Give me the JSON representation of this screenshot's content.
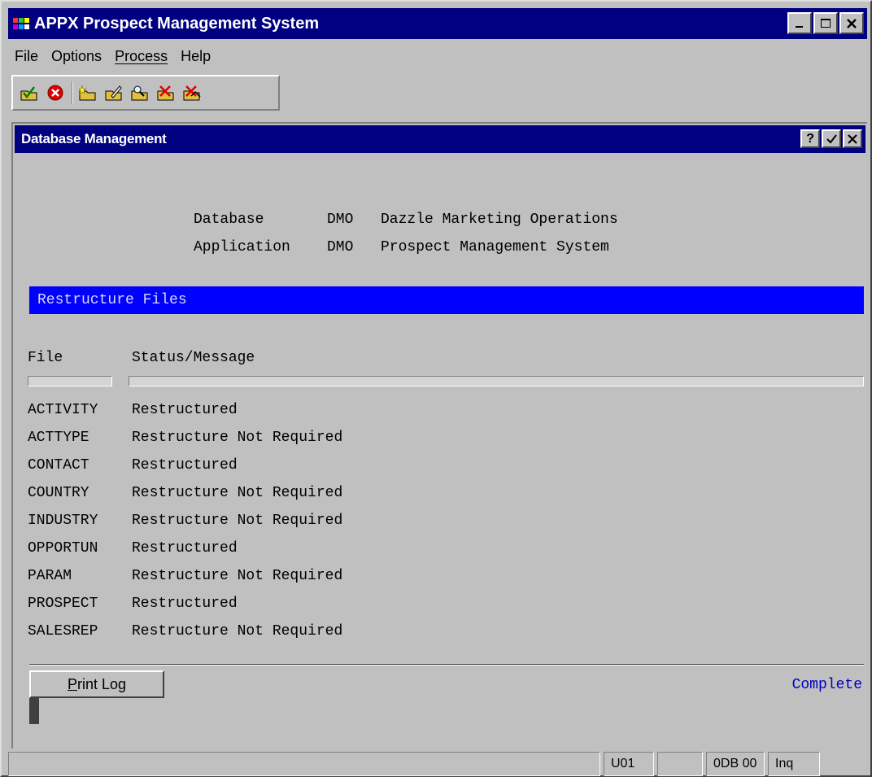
{
  "window": {
    "title": "APPX Prospect Management System"
  },
  "menu": [
    {
      "label": "File"
    },
    {
      "label": "Options"
    },
    {
      "label": "Process"
    },
    {
      "label": "Help"
    }
  ],
  "subwindow": {
    "title": "Database Management"
  },
  "header": {
    "database_label": "Database",
    "database_code": "DMO",
    "database_name": "Dazzle Marketing Operations",
    "application_label": "Application",
    "application_code": "DMO",
    "application_name": "Prospect Management System"
  },
  "section_title": "Restructure Files",
  "columns": {
    "file": "File",
    "status": "Status/Message"
  },
  "rows": [
    {
      "file": "ACTIVITY",
      "status": "Restructured"
    },
    {
      "file": "ACTTYPE",
      "status": "Restructure Not Required"
    },
    {
      "file": "CONTACT",
      "status": "Restructured"
    },
    {
      "file": "COUNTRY",
      "status": "Restructure Not Required"
    },
    {
      "file": "INDUSTRY",
      "status": "Restructure Not Required"
    },
    {
      "file": "OPPORTUN",
      "status": "Restructured"
    },
    {
      "file": "PARAM",
      "status": "Restructure Not Required"
    },
    {
      "file": "PROSPECT",
      "status": "Restructured"
    },
    {
      "file": "SALESREP",
      "status": "Restructure Not Required"
    }
  ],
  "print_button": {
    "underlined": "P",
    "rest": "rint Log"
  },
  "completion_status": "Complete",
  "statusbar": {
    "user": "U01",
    "blank": "",
    "db": "0DB 00",
    "mode": "Inq"
  },
  "colors": {
    "titlebar": "#000080",
    "banner": "#0000ff",
    "complete": "#0000c0"
  }
}
